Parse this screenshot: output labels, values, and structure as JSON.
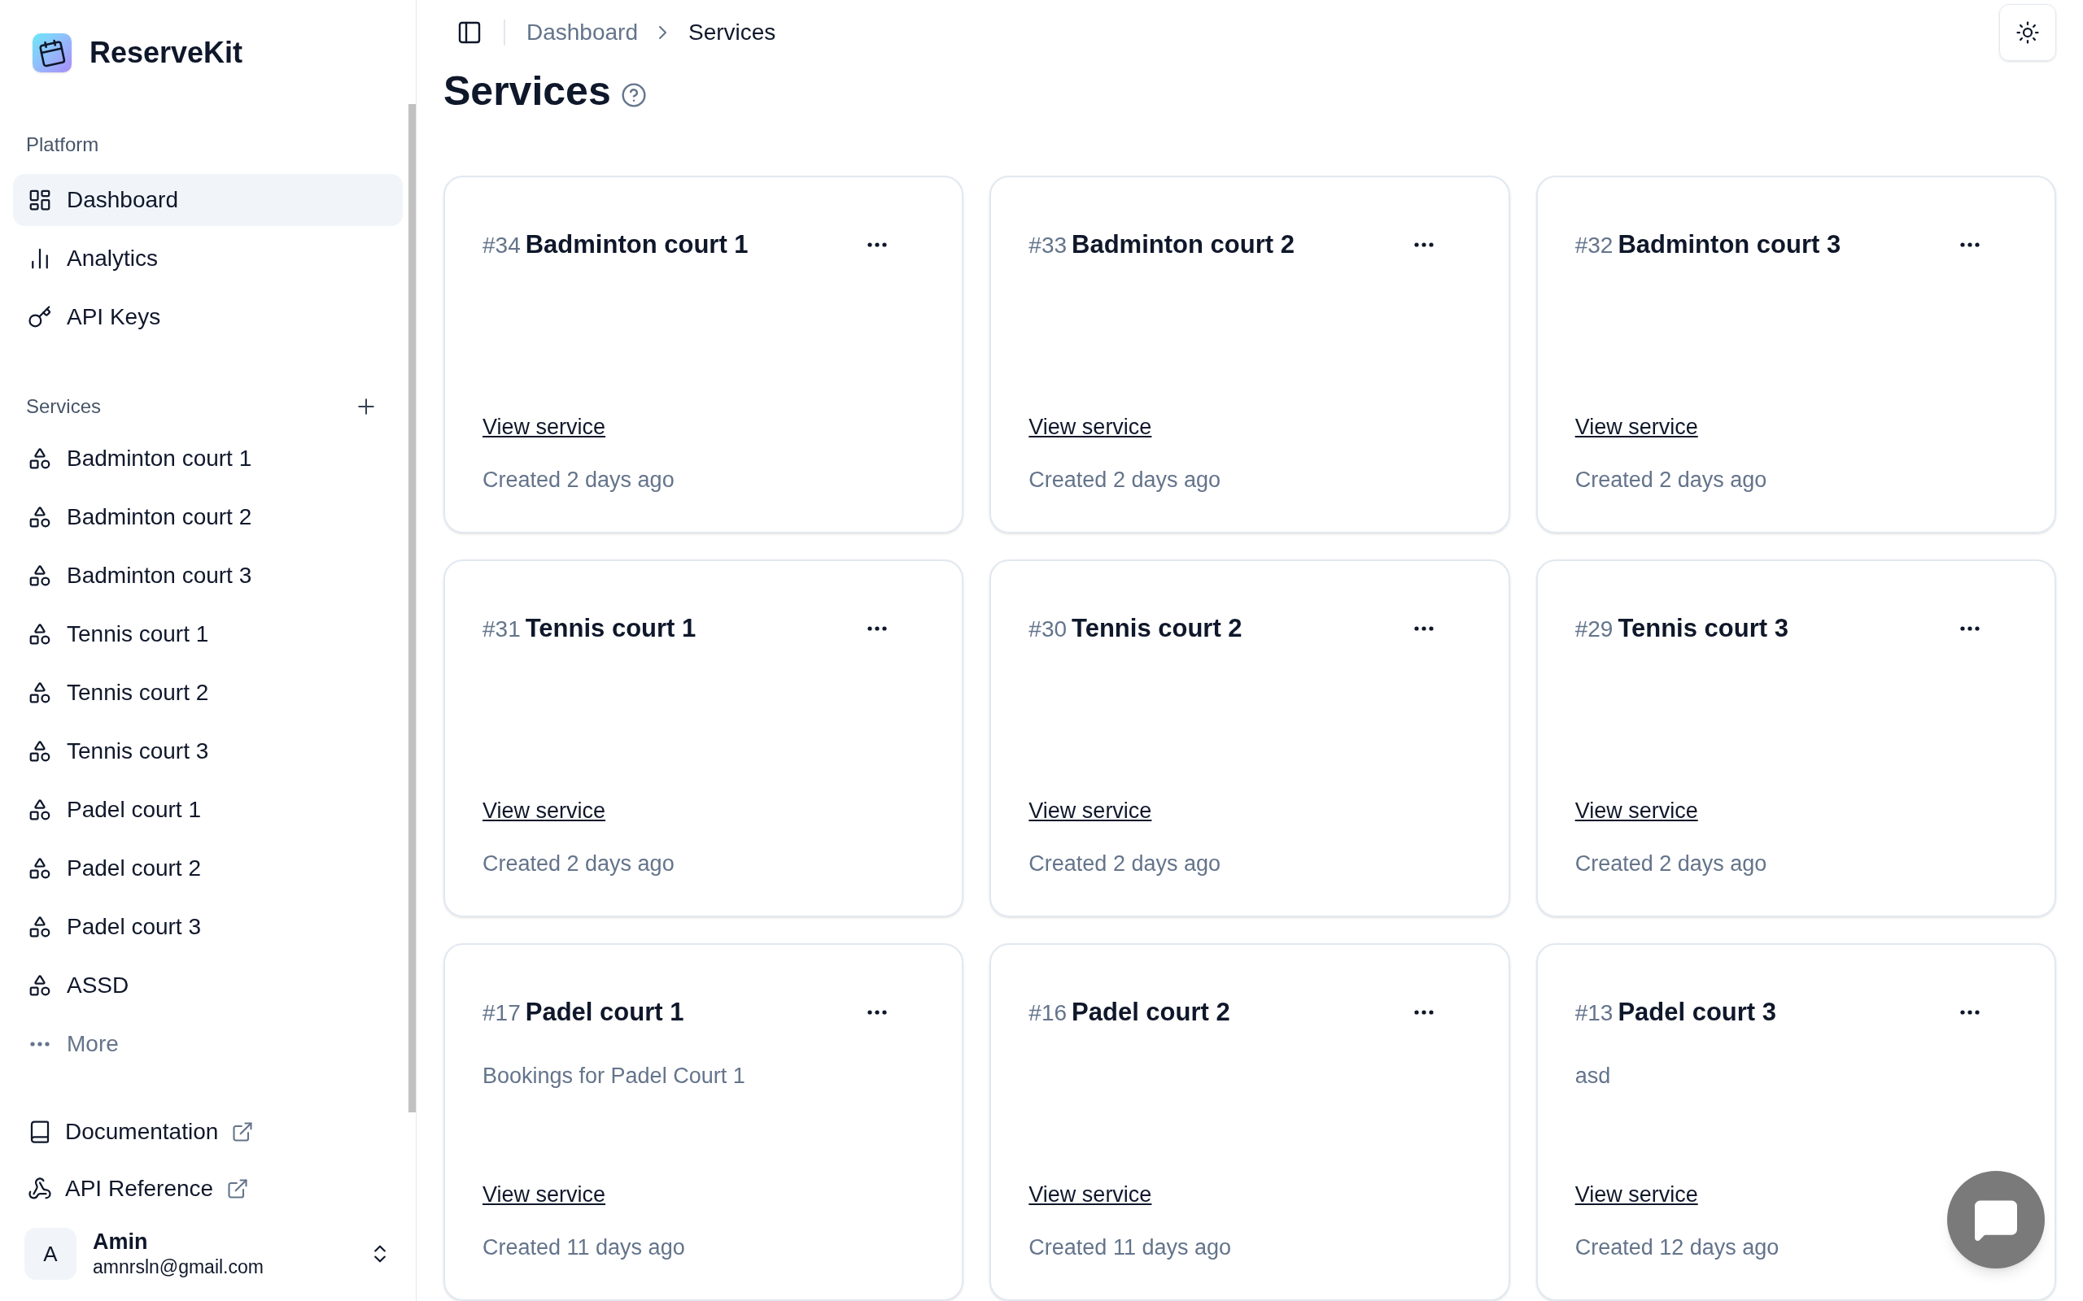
{
  "brand": {
    "name": "ReserveKit"
  },
  "sidebar": {
    "platform": {
      "label": "Platform",
      "items": [
        {
          "label": "Dashboard",
          "kind": "grid",
          "selected": true
        },
        {
          "label": "Analytics",
          "kind": "bars",
          "selected": false
        },
        {
          "label": "API Keys",
          "kind": "key",
          "selected": false
        }
      ]
    },
    "services": {
      "label": "Services",
      "items": [
        {
          "label": "Badminton court 1",
          "kind": "service",
          "selected": false
        },
        {
          "label": "Badminton court 2",
          "kind": "service",
          "selected": false
        },
        {
          "label": "Badminton court 3",
          "kind": "service",
          "selected": false
        },
        {
          "label": "Tennis court 1",
          "kind": "service",
          "selected": false
        },
        {
          "label": "Tennis court 2",
          "kind": "service",
          "selected": false
        },
        {
          "label": "Tennis court 3",
          "kind": "service",
          "selected": false
        },
        {
          "label": "Padel court 1",
          "kind": "service",
          "selected": false
        },
        {
          "label": "Padel court 2",
          "kind": "service",
          "selected": false
        },
        {
          "label": "Padel court 3",
          "kind": "service",
          "selected": false
        },
        {
          "label": "ASSD",
          "kind": "service",
          "selected": false
        },
        {
          "label": "More",
          "kind": "more",
          "selected": false
        }
      ]
    },
    "links": [
      {
        "label": "Documentation",
        "kind": "docs"
      },
      {
        "label": "API Reference",
        "kind": "api"
      }
    ],
    "user": {
      "initial": "A",
      "name": "Amin",
      "email": "amnrsln@gmail.com"
    }
  },
  "breadcrumb": [
    "Dashboard",
    "Services"
  ],
  "page": {
    "title": "Services"
  },
  "cards": [
    {
      "number": "#34",
      "name": "Badminton court 1",
      "link": "View service",
      "created": "Created 2 days ago"
    },
    {
      "number": "#33",
      "name": "Badminton court 2",
      "link": "View service",
      "created": "Created 2 days ago"
    },
    {
      "number": "#32",
      "name": "Badminton court 3",
      "link": "View service",
      "created": "Created 2 days ago"
    },
    {
      "number": "#31",
      "name": "Tennis court 1",
      "link": "View service",
      "created": "Created 2 days ago"
    },
    {
      "number": "#30",
      "name": "Tennis court 2",
      "link": "View service",
      "created": "Created 2 days ago"
    },
    {
      "number": "#29",
      "name": "Tennis court 3",
      "link": "View service",
      "created": "Created 2 days ago"
    },
    {
      "number": "#17",
      "name": "Padel court 1",
      "description": "Bookings for Padel Court 1",
      "link": "View service",
      "created": "Created 11 days ago"
    },
    {
      "number": "#16",
      "name": "Padel court 2",
      "link": "View service",
      "created": "Created 11 days ago"
    },
    {
      "number": "#13",
      "name": "Padel court 3",
      "description": "asd",
      "link": "View service",
      "created": "Created 12 days ago"
    }
  ]
}
